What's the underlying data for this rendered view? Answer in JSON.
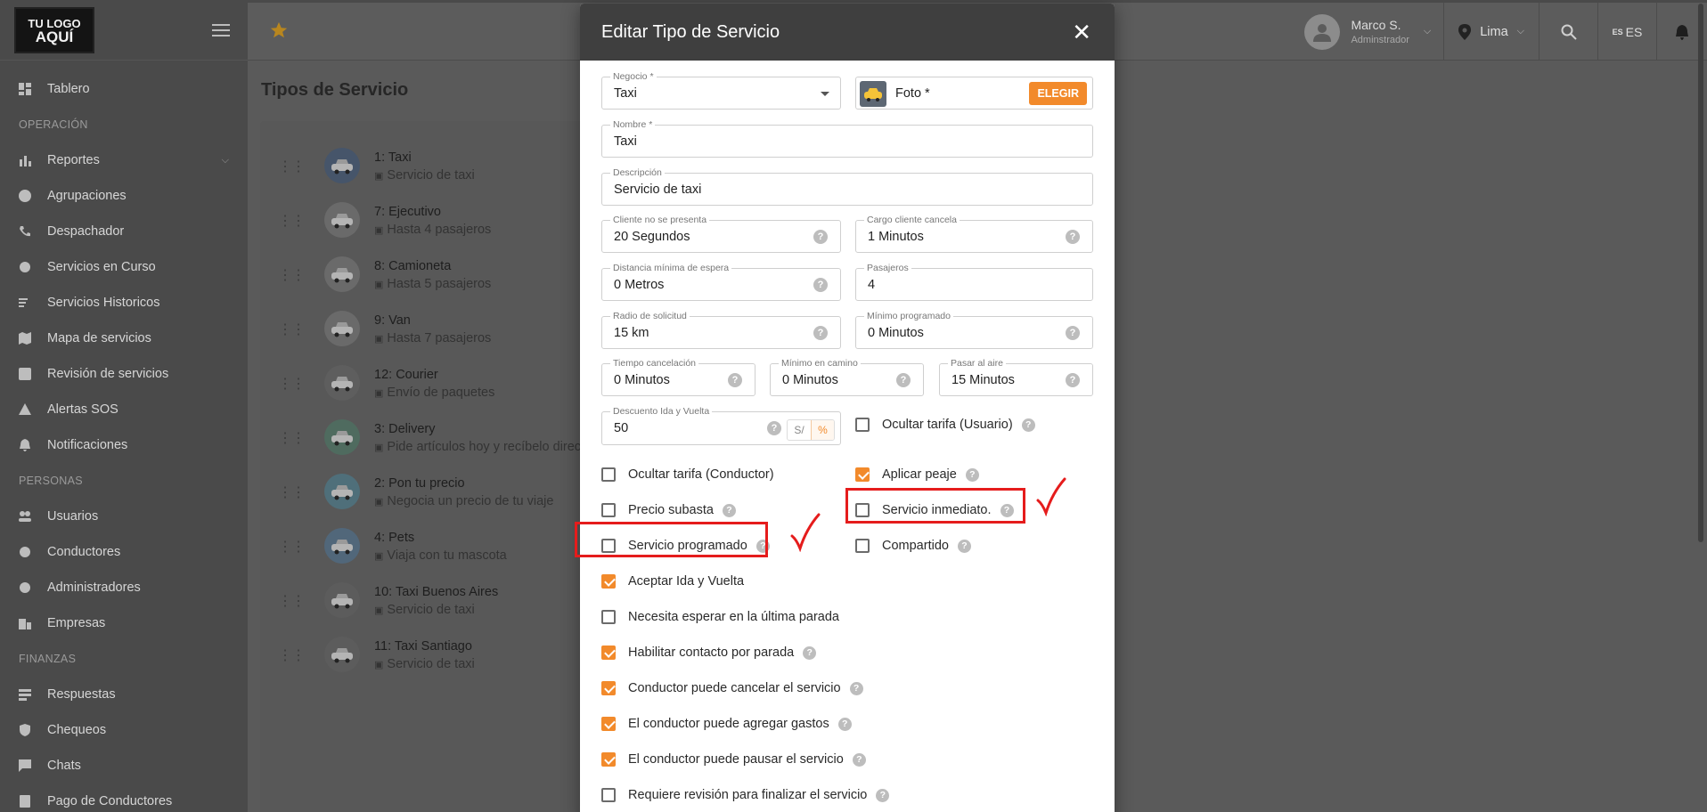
{
  "logo": {
    "line1": "TU LOGO",
    "line2": "AQUÍ"
  },
  "sidebar": {
    "sections": [
      {
        "items": [
          {
            "label": "Tablero",
            "icon": "dashboard-icon"
          }
        ]
      },
      {
        "title": "OPERACIÓN",
        "items": [
          {
            "label": "Reportes",
            "icon": "bar-chart-icon",
            "expand": true
          },
          {
            "label": "Agrupaciones",
            "icon": "group-work-icon"
          },
          {
            "label": "Despachador",
            "icon": "phone-forward-icon"
          },
          {
            "label": "Servicios en Curso",
            "icon": "circle-icon"
          },
          {
            "label": "Servicios Historicos",
            "icon": "list-icon"
          },
          {
            "label": "Mapa de servicios",
            "icon": "map-icon"
          },
          {
            "label": "Revisión de servicios",
            "icon": "review-icon"
          },
          {
            "label": "Alertas SOS",
            "icon": "warning-icon"
          },
          {
            "label": "Notificaciones",
            "icon": "bell-icon"
          }
        ]
      },
      {
        "title": "PERSONAS",
        "items": [
          {
            "label": "Usuarios",
            "icon": "people-icon"
          },
          {
            "label": "Conductores",
            "icon": "driver-icon"
          },
          {
            "label": "Administradores",
            "icon": "admin-icon"
          },
          {
            "label": "Empresas",
            "icon": "business-icon"
          }
        ]
      },
      {
        "title": "FINANZAS",
        "items": [
          {
            "label": "Respuestas",
            "icon": "reply-icon"
          },
          {
            "label": "Chequeos",
            "icon": "shield-check-icon"
          },
          {
            "label": "Chats",
            "icon": "chat-icon"
          },
          {
            "label": "Pago de Conductores",
            "icon": "payment-icon"
          }
        ]
      }
    ]
  },
  "topbar": {
    "user_name": "Marco S.",
    "user_role": "Adminstrador",
    "location": "Lima",
    "lang_small": "ES",
    "lang": "ES"
  },
  "page_title": "Tipos de Servicio",
  "services": [
    {
      "id": "1",
      "name": "Taxi",
      "desc": "Servicio de taxi"
    },
    {
      "id": "7",
      "name": "Ejecutivo",
      "desc": "Hasta 4 pasajeros"
    },
    {
      "id": "8",
      "name": "Camioneta",
      "desc": "Hasta 5 pasajeros"
    },
    {
      "id": "9",
      "name": "Van",
      "desc": "Hasta 7 pasajeros"
    },
    {
      "id": "12",
      "name": "Courier",
      "desc": "Envío de paquetes"
    },
    {
      "id": "3",
      "name": "Delivery",
      "desc": "Pide artículos hoy y recíbelo direc"
    },
    {
      "id": "2",
      "name": "Pon tu precio",
      "desc": "Negocia un precio de tu viaje"
    },
    {
      "id": "4",
      "name": "Pets",
      "desc": "Viaja con tu mascota"
    },
    {
      "id": "10",
      "name": "Taxi Buenos Aires",
      "desc": "Servicio de taxi"
    },
    {
      "id": "11",
      "name": "Taxi Santiago",
      "desc": "Servicio de taxi"
    }
  ],
  "modal": {
    "title": "Editar Tipo de Servicio",
    "close": "✕",
    "negocio": {
      "label": "Negocio *",
      "value": "Taxi"
    },
    "foto": {
      "label": "Foto *",
      "button": "ELEGIR"
    },
    "nombre": {
      "label": "Nombre *",
      "value": "Taxi"
    },
    "descripcion": {
      "label": "Descripción",
      "value": "Servicio de taxi"
    },
    "cliente_no_presenta": {
      "label": "Cliente no se presenta",
      "value": "20 Segundos"
    },
    "cargo_cliente_cancela": {
      "label": "Cargo cliente cancela",
      "value": "1 Minutos"
    },
    "distancia_minima": {
      "label": "Distancia mínima de espera",
      "value": "0 Metros"
    },
    "pasajeros": {
      "label": "Pasajeros",
      "value": "4"
    },
    "radio_solicitud": {
      "label": "Radio de solicitud",
      "value": "15 km"
    },
    "minimo_programado": {
      "label": "Mínimo programado",
      "value": "0 Minutos"
    },
    "tiempo_cancelacion": {
      "label": "Tiempo cancelación",
      "value": "0 Minutos"
    },
    "minimo_en_camino": {
      "label": "Mínimo en camino",
      "value": "0 Minutos"
    },
    "pasar_al_aire": {
      "label": "Pasar al aire",
      "value": "15 Minutos"
    },
    "descuento": {
      "label": "Descuento Ida y Vuelta",
      "value": "50",
      "unit_a": "S/",
      "unit_b": "%"
    },
    "checkboxes": [
      {
        "label": "Ocultar tarifa (Usuario)",
        "checked": false,
        "help": true
      },
      {
        "label": "Ocultar tarifa (Conductor)",
        "checked": false,
        "help": false
      },
      {
        "label": "Aplicar peaje",
        "checked": true,
        "help": true
      },
      {
        "label": "Precio subasta",
        "checked": false,
        "help": true
      },
      {
        "label": "Servicio inmediato.",
        "checked": false,
        "help": true
      },
      {
        "label": "Servicio programado",
        "checked": false,
        "help": true
      },
      {
        "label": "Compartido",
        "checked": false,
        "help": true
      },
      {
        "label": "Aceptar Ida y Vuelta",
        "checked": true,
        "help": false
      },
      {
        "label": "Necesita esperar en la última parada",
        "checked": false,
        "help": false
      },
      {
        "label": "Habilitar contacto por parada",
        "checked": true,
        "help": true
      },
      {
        "label": "Conductor puede cancelar el servicio",
        "checked": true,
        "help": true
      },
      {
        "label": "El conductor puede agregar gastos",
        "checked": true,
        "help": true
      },
      {
        "label": "El conductor puede pausar el servicio",
        "checked": true,
        "help": true
      },
      {
        "label": "Requiere revisión para finalizar el servicio",
        "checked": false,
        "help": true
      }
    ],
    "help_glyph": "?"
  },
  "colors": {
    "accent": "#f28a2b",
    "annotation": "#e51c1c"
  }
}
